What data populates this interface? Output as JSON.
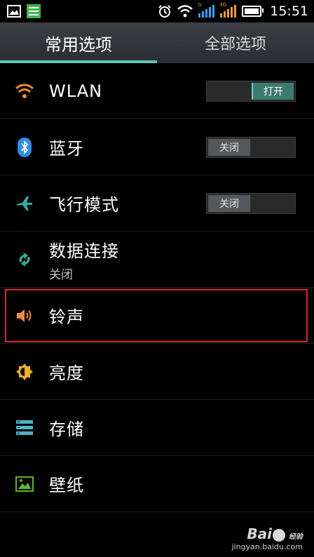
{
  "status_bar": {
    "time": "15:51",
    "signal1_label": "G",
    "signal2_label": "3G",
    "notification_icons": [
      "image-notification-icon",
      "app-notification-icon"
    ]
  },
  "tabs": [
    {
      "label": "常用选项",
      "active": true
    },
    {
      "label": "全部选项",
      "active": false
    }
  ],
  "settings": {
    "wlan": {
      "title": "WLAN",
      "toggle": "打开",
      "icon": "wifi-icon"
    },
    "bluetooth": {
      "title": "蓝牙",
      "toggle": "关闭",
      "icon": "bluetooth-icon"
    },
    "airplane": {
      "title": "飞行模式",
      "toggle": "关闭",
      "icon": "airplane-icon"
    },
    "data": {
      "title": "数据连接",
      "subtitle": "关闭",
      "icon": "data-sync-icon"
    },
    "ringtone": {
      "title": "铃声",
      "icon": "speaker-icon",
      "highlighted": true
    },
    "brightness": {
      "title": "亮度",
      "icon": "brightness-icon"
    },
    "storage": {
      "title": "存储",
      "icon": "storage-icon"
    },
    "wallpaper": {
      "title": "壁纸",
      "icon": "wallpaper-icon"
    }
  },
  "watermark": {
    "brand": "Bai",
    "brand_suffix": "经验",
    "url": "jingyan.baidu.com"
  },
  "colors": {
    "accent": "#5fc3b5",
    "highlight": "#e0202a",
    "wifi": "#f08a3c",
    "bluetooth": "#2f8ce8",
    "airplane": "#2ab3a0",
    "brightness": "#f0b020",
    "storage": "#4fb3c8",
    "wallpaper": "#58b82e"
  }
}
